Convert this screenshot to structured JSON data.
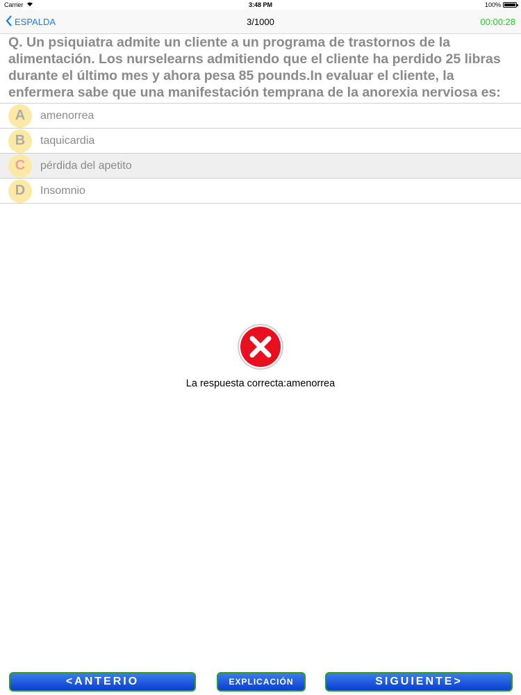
{
  "status": {
    "carrier": "Carrier",
    "time": "3:48 PM",
    "battery": "100%"
  },
  "nav": {
    "back_label": "ESPALDA",
    "progress": "3/1000",
    "timer": "00:00:28"
  },
  "question": {
    "text": "Q. Un psiquiatra admite un cliente a un programa de trastornos de la alimentación. Los nurselearns admitiendo que el cliente ha perdido 25 libras durante el último mes y ahora pesa 85 pounds.In evaluar el cliente, la enfermera sabe que una manifestación temprana de la anorexia nerviosa es:"
  },
  "options": [
    {
      "letter": "A",
      "text": "amenorrea"
    },
    {
      "letter": "B",
      "text": "taquicardia"
    },
    {
      "letter": "C",
      "text": "pérdida del apetito"
    },
    {
      "letter": "D",
      "text": "Insomnio"
    }
  ],
  "result": {
    "status": "incorrect",
    "text": "La respuesta correcta:amenorrea",
    "icon": "red-x-icon"
  },
  "buttons": {
    "prev": "<ANTERIO",
    "explanation": "EXPLICACIÓN",
    "next": "SIGUIENTE>"
  },
  "colors": {
    "accent": "#1a7df0",
    "timer": "#22cc22",
    "error": "#e8101e",
    "button": "#0a3fd0"
  }
}
